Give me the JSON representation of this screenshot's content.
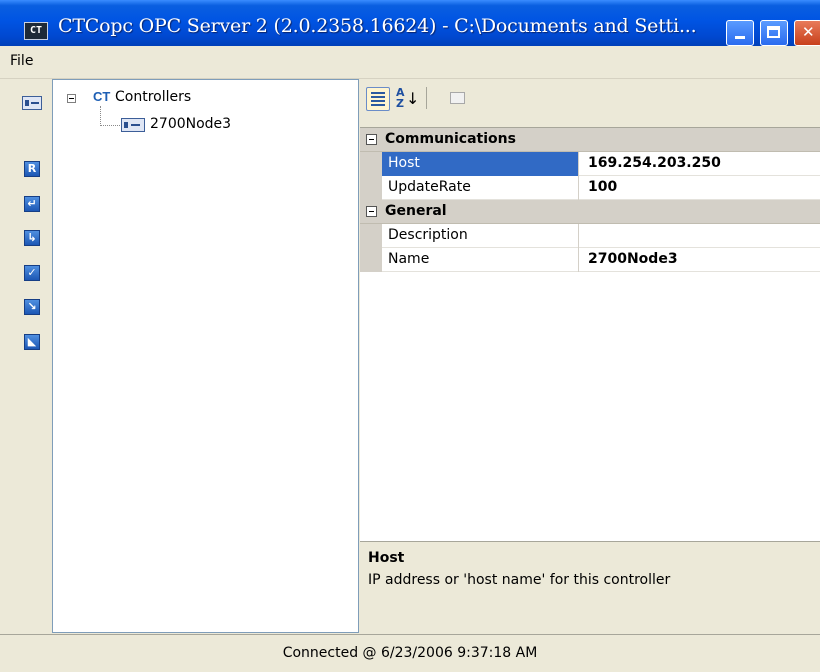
{
  "window": {
    "icon_text": "CT",
    "title": "CTCopc OPC Server 2 (2.0.2358.16624) - C:\\Documents and Setti..."
  },
  "menu": {
    "items": [
      {
        "label": "File"
      }
    ]
  },
  "left_toolbar": {
    "icons": [
      {
        "name": "controller-icon",
        "glyph": ""
      },
      {
        "name": "r-icon",
        "glyph": "R"
      },
      {
        "name": "return-arrow-icon",
        "glyph": "↵"
      },
      {
        "name": "step-down-icon",
        "glyph": "↳"
      },
      {
        "name": "check-icon",
        "glyph": "✓"
      },
      {
        "name": "arrow-down-right-icon",
        "glyph": "↘"
      },
      {
        "name": "shape-icon",
        "glyph": "◣"
      }
    ]
  },
  "tree": {
    "root": {
      "label": "Controllers",
      "icon": "ct-logo-icon"
    },
    "children": [
      {
        "label": "2700Node3",
        "icon": "controller-node-icon"
      }
    ]
  },
  "property_toolbar": {
    "categorized": "categorized-icon",
    "sort_text": "A\nZ",
    "sort_arrow": "↓",
    "pages": "property-pages-icon"
  },
  "property_grid": {
    "categories": [
      {
        "label": "Communications",
        "properties": [
          {
            "name": "Host",
            "value": "169.254.203.250",
            "selected": true
          },
          {
            "name": "UpdateRate",
            "value": "100"
          }
        ]
      },
      {
        "label": "General",
        "properties": [
          {
            "name": "Description",
            "value": ""
          },
          {
            "name": "Name",
            "value": "2700Node3"
          }
        ]
      }
    ]
  },
  "description": {
    "title": "Host",
    "text": "IP address or 'host name' for this controller"
  },
  "status": {
    "text": "Connected @ 6/23/2006 9:37:18 AM"
  },
  "colors": {
    "selection": "#316ac5",
    "titlebar": "#0054e3",
    "chrome": "#ece9d8"
  }
}
